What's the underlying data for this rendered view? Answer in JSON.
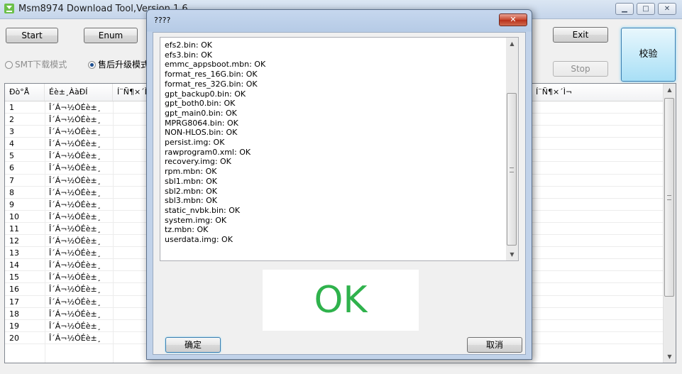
{
  "main_window": {
    "title": "Msm8974 Download Tool,Version 1.6",
    "buttons": {
      "start": "Start",
      "enum": "Enum",
      "exit": "Exit",
      "stop": "Stop",
      "verify": "校验"
    },
    "modes": {
      "smt": "SMT下载模式",
      "aftersale": "售后升级模式"
    },
    "list": {
      "headers": [
        "Đò°Å",
        "Éè±¸ÀàÐÍ",
        "Í¨Ñ¶×´Ì¬",
        "Í¨Ñ¶×´Ì¬"
      ],
      "row_status": "Î´Á¬½ÓÉè±¸",
      "rows": [
        "1",
        "2",
        "3",
        "4",
        "5",
        "6",
        "7",
        "8",
        "9",
        "10",
        "11",
        "12",
        "13",
        "14",
        "15",
        "16",
        "17",
        "18",
        "19",
        "20"
      ]
    }
  },
  "dialog": {
    "title": "????",
    "close_label": "✕",
    "log_lines": [
      "efs2.bin: OK",
      "efs3.bin: OK",
      "emmc_appsboot.mbn: OK",
      "format_res_16G.bin: OK",
      "format_res_32G.bin: OK",
      "gpt_backup0.bin: OK",
      "gpt_both0.bin: OK",
      "gpt_main0.bin: OK",
      "MPRG8064.bin: OK",
      "NON-HLOS.bin: OK",
      "persist.img: OK",
      "rawprogram0.xml: OK",
      "recovery.img: OK",
      "rpm.mbn: OK",
      "sbl1.mbn: OK",
      "sbl2.mbn: OK",
      "sbl3.mbn: OK",
      "static_nvbk.bin: OK",
      "system.img: OK",
      "tz.mbn: OK",
      "userdata.img: OK"
    ],
    "result": "OK",
    "ok_button": "确定",
    "cancel_button": "取消"
  },
  "colors": {
    "result_green": "#2fb24c",
    "close_red": "#c7472e",
    "accent_blue": "#3c7fb1"
  }
}
